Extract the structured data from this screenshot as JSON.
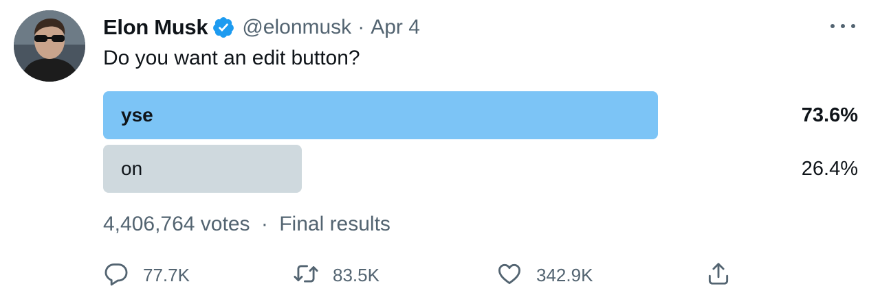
{
  "tweet": {
    "author_name": "Elon Musk",
    "handle": "@elonmusk",
    "separator": "·",
    "date": "Apr 4",
    "text": "Do you want an edit button?"
  },
  "poll": {
    "options": [
      {
        "label": "yse",
        "percent_text": "73.6%",
        "percent": 73.6,
        "winner": true
      },
      {
        "label": "on",
        "percent_text": "26.4%",
        "percent": 26.4,
        "winner": false
      }
    ],
    "votes_text": "4,406,764 votes",
    "separator": "·",
    "status": "Final results"
  },
  "actions": {
    "replies": "77.7K",
    "retweets": "83.5K",
    "likes": "342.9K"
  },
  "colors": {
    "winner_bar": "#7cc4f6",
    "loser_bar": "#cfd9de",
    "verified": "#1d9bf0",
    "secondary_text": "#536471"
  },
  "icons": [
    "verified-badge-icon",
    "more-icon",
    "reply-icon",
    "retweet-icon",
    "like-icon",
    "share-icon"
  ]
}
